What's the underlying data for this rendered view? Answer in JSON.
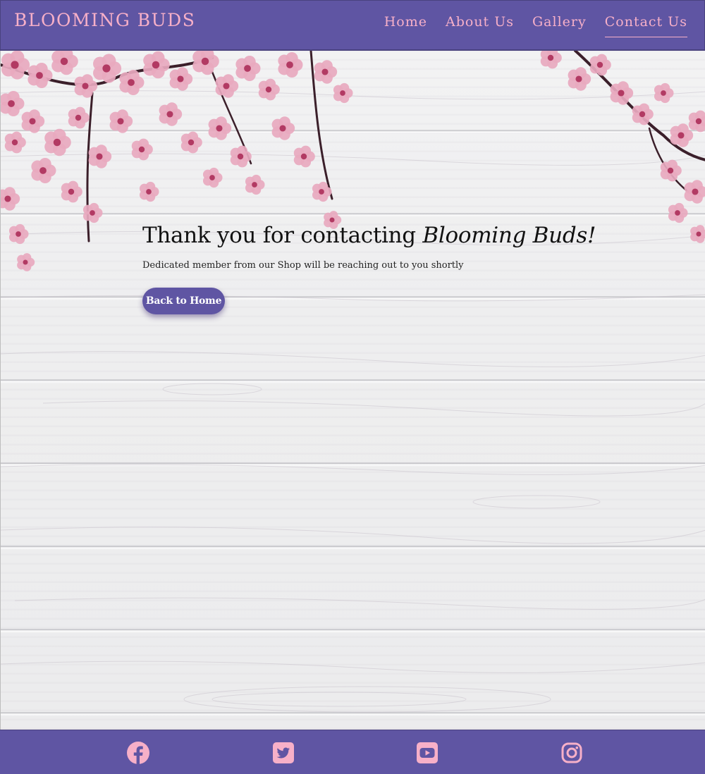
{
  "header": {
    "brand": "BLOOMING BUDS",
    "nav": [
      {
        "label": "Home"
      },
      {
        "label": "About Us"
      },
      {
        "label": "Gallery"
      },
      {
        "label": "Contact Us",
        "active": true
      }
    ]
  },
  "main": {
    "heading_plain": "Thank you for contacting ",
    "heading_emphasis": "Blooming Buds!",
    "subtext": "Dedicated member from our Shop will be reaching out to you shortly",
    "button_label": "Back to Home"
  },
  "footer": {
    "social_icons": [
      "facebook-icon",
      "twitter-icon",
      "youtube-icon",
      "instagram-icon"
    ]
  },
  "colors": {
    "brand_purple": "#5f55a3",
    "brand_pink": "#f7b0c8",
    "blossom_pink": "#e8a9bf",
    "blossom_dark": "#b23a63",
    "branch": "#3b1f2a"
  }
}
